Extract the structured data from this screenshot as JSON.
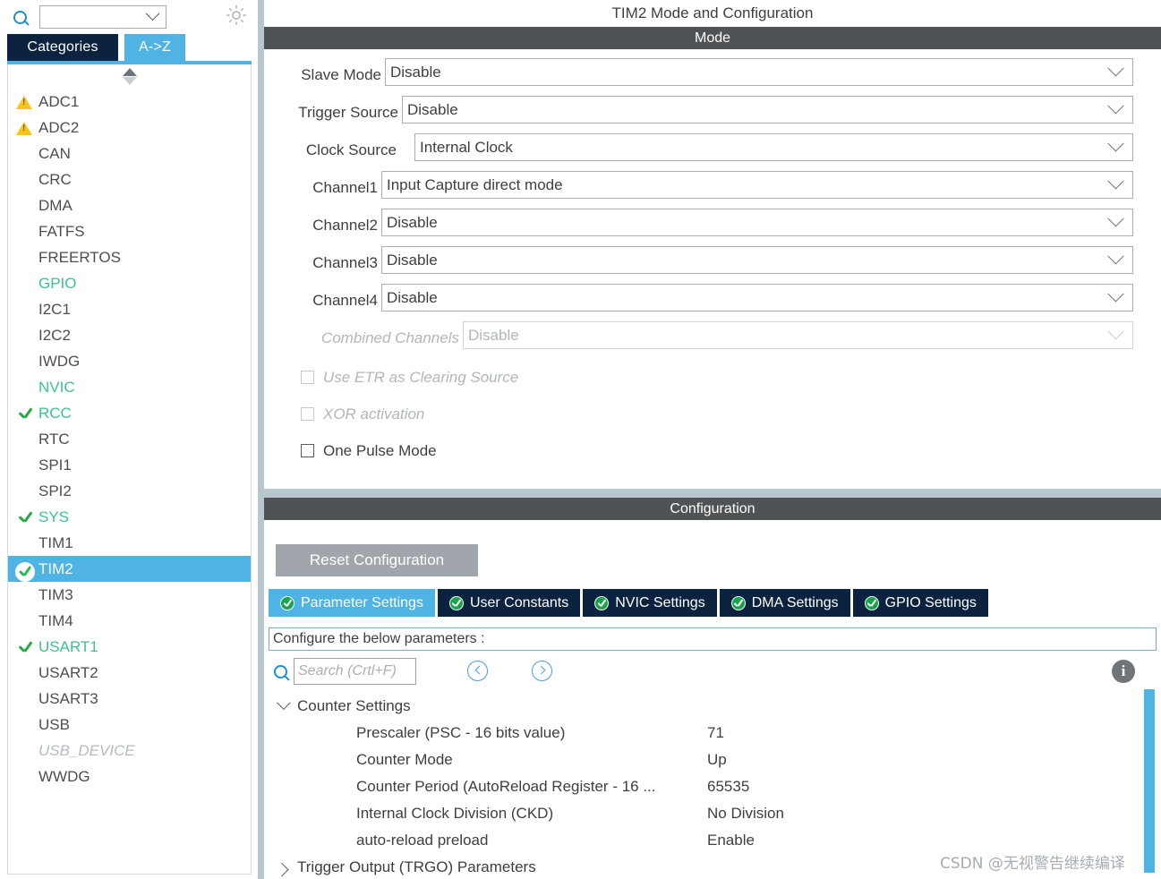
{
  "sidebar": {
    "search": {
      "value": "",
      "placeholder": ""
    },
    "gear_label": "gear-icon",
    "tabs": [
      {
        "label": "Categories",
        "active": false
      },
      {
        "label": "A->Z",
        "active": true
      }
    ],
    "items": [
      {
        "label": "ADC1",
        "status": "warning"
      },
      {
        "label": "ADC2",
        "status": "warning"
      },
      {
        "label": "CAN",
        "status": "none"
      },
      {
        "label": "CRC",
        "status": "none"
      },
      {
        "label": "DMA",
        "status": "none"
      },
      {
        "label": "FATFS",
        "status": "none"
      },
      {
        "label": "FREERTOS",
        "status": "none"
      },
      {
        "label": "GPIO",
        "status": "configured-green"
      },
      {
        "label": "I2C1",
        "status": "none"
      },
      {
        "label": "I2C2",
        "status": "none"
      },
      {
        "label": "IWDG",
        "status": "none"
      },
      {
        "label": "NVIC",
        "status": "configured-green"
      },
      {
        "label": "RCC",
        "status": "check-green"
      },
      {
        "label": "RTC",
        "status": "none"
      },
      {
        "label": "SPI1",
        "status": "none"
      },
      {
        "label": "SPI2",
        "status": "none"
      },
      {
        "label": "SYS",
        "status": "check-green"
      },
      {
        "label": "TIM1",
        "status": "none"
      },
      {
        "label": "TIM2",
        "status": "selected-check"
      },
      {
        "label": "TIM3",
        "status": "none"
      },
      {
        "label": "TIM4",
        "status": "none"
      },
      {
        "label": "USART1",
        "status": "check-green"
      },
      {
        "label": "USART2",
        "status": "none"
      },
      {
        "label": "USART3",
        "status": "none"
      },
      {
        "label": "USB",
        "status": "none"
      },
      {
        "label": "USB_DEVICE",
        "status": "disabled"
      },
      {
        "label": "WWDG",
        "status": "none"
      }
    ]
  },
  "header": {
    "title": "TIM2 Mode and Configuration"
  },
  "mode": {
    "band_title": "Mode",
    "fields": [
      {
        "label": "Slave Mode",
        "value": "Disable",
        "disabled": false
      },
      {
        "label": "Trigger Source",
        "value": "Disable",
        "disabled": false
      },
      {
        "label": "Clock Source",
        "value": "Internal Clock",
        "disabled": false
      },
      {
        "label": "Channel1",
        "value": "Input Capture direct mode",
        "disabled": false
      },
      {
        "label": "Channel2",
        "value": "Disable",
        "disabled": false
      },
      {
        "label": "Channel3",
        "value": "Disable",
        "disabled": false
      },
      {
        "label": "Channel4",
        "value": "Disable",
        "disabled": false
      },
      {
        "label": "Combined Channels",
        "value": "Disable",
        "disabled": true
      }
    ],
    "checkboxes": [
      {
        "label": "Use ETR as Clearing Source",
        "checked": false,
        "disabled": true
      },
      {
        "label": "XOR activation",
        "checked": false,
        "disabled": true
      },
      {
        "label": "One Pulse Mode",
        "checked": false,
        "disabled": false
      }
    ]
  },
  "configuration": {
    "band_title": "Configuration",
    "reset_label": "Reset Configuration",
    "tabs": [
      {
        "label": "Parameter Settings",
        "active": true
      },
      {
        "label": "User Constants",
        "active": false
      },
      {
        "label": "NVIC Settings",
        "active": false
      },
      {
        "label": "DMA Settings",
        "active": false
      },
      {
        "label": "GPIO Settings",
        "active": false
      }
    ],
    "configure_hint": "Configure the below parameters :",
    "search": {
      "value": "",
      "placeholder": "Search (Crtl+F)"
    },
    "tree": {
      "group1": {
        "label": "Counter Settings",
        "expanded": true
      },
      "rows": [
        {
          "name": "Prescaler (PSC - 16 bits value)",
          "value": "71"
        },
        {
          "name": "Counter Mode",
          "value": "Up"
        },
        {
          "name": "Counter Period (AutoReload Register - 16 ...",
          "value": "65535"
        },
        {
          "name": "Internal Clock Division (CKD)",
          "value": "No Division"
        },
        {
          "name": "auto-reload preload",
          "value": "Enable"
        }
      ],
      "group2": {
        "label": "Trigger Output (TRGO) Parameters",
        "expanded": false
      }
    }
  },
  "watermark": "CSDN @无视警告继续编译",
  "colors": {
    "accent_blue": "#4fb3e3",
    "navy": "#0c2340",
    "band_gray": "#4f5355",
    "green": "#2eb857",
    "warning_yellow": "#f5c518",
    "panel_gap": "#b8c6ce"
  }
}
